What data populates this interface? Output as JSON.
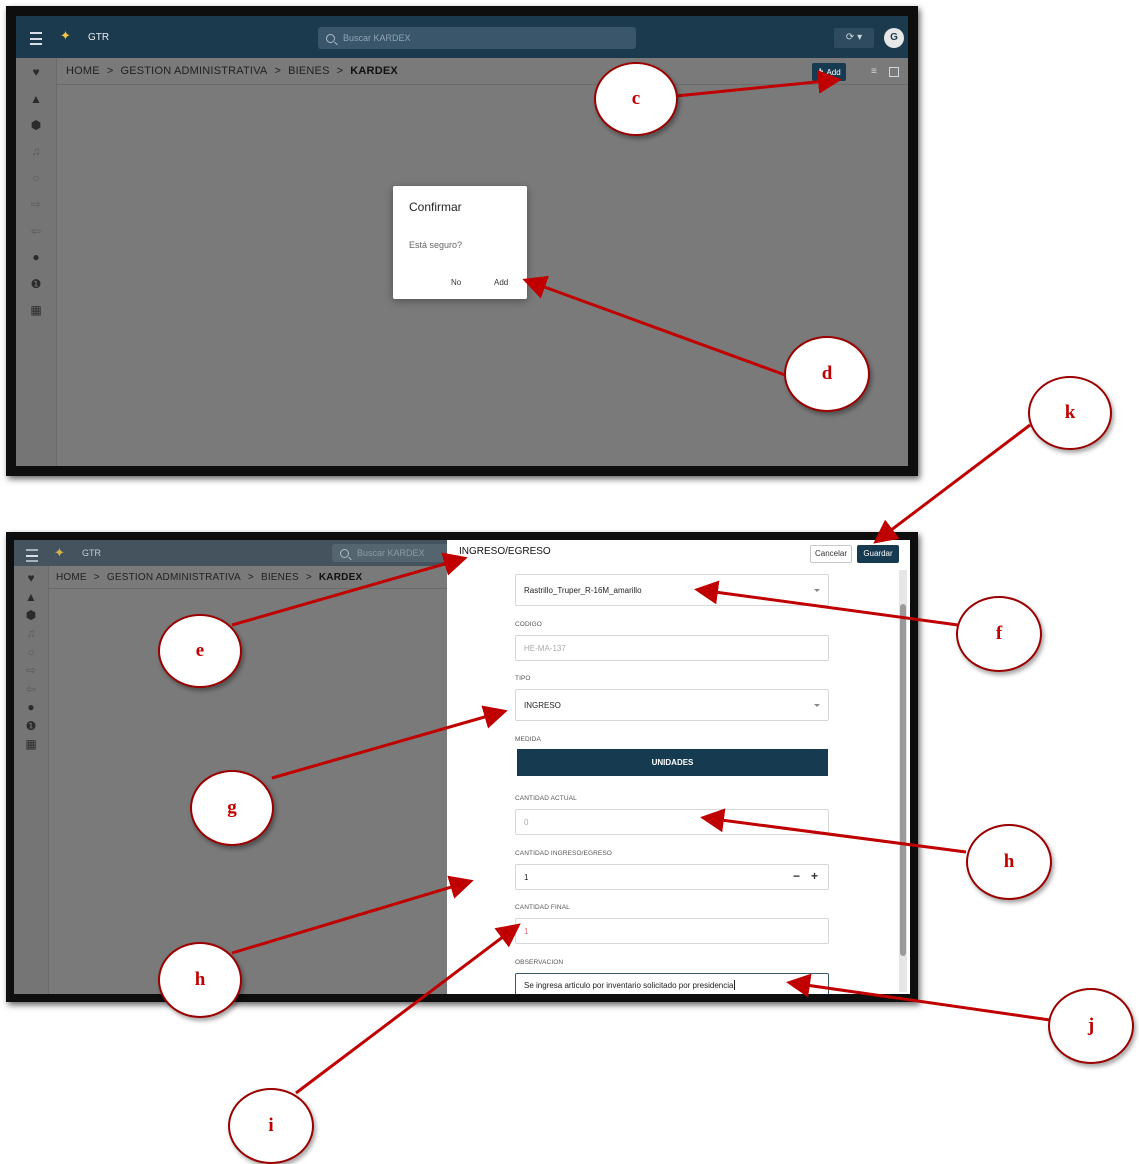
{
  "app": {
    "title": "GTR",
    "search_placeholder": "Buscar KARDEX",
    "avatar_initial": "G",
    "sync_label": "⟳  ▾"
  },
  "breadcrumb": {
    "items": [
      "HOME",
      "GESTION ADMINISTRATIVA",
      "BIENES"
    ],
    "current": "KARDEX",
    "separator": ">"
  },
  "toolbar": {
    "add_label": "Add"
  },
  "dialog": {
    "title": "Confirmar",
    "message": "Está seguro?",
    "no_label": "No",
    "add_label": "Add"
  },
  "form": {
    "title": "INGRESO/EGRESO",
    "cancel_label": "Cancelar",
    "save_label": "Guardar",
    "item_value": "Rastrillo_Truper_R-16M_amarillo",
    "codigo_label": "CODIGO",
    "codigo_value": "HE-MA-137",
    "tipo_label": "TIPO",
    "tipo_value": "INGRESO",
    "medida_label": "MEDIDA",
    "medida_value": "UNIDADES",
    "cantidad_actual_label": "CANTIDAD ACTUAL",
    "cantidad_actual_value": "0",
    "cantidad_ie_label": "CANTIDAD INGRESO/EGRESO",
    "cantidad_ie_value": "1",
    "cantidad_final_label": "CANTIDAD FINAL",
    "cantidad_final_value": "1",
    "observacion_label": "OBSERVACION",
    "observacion_value": "Se ingresa articulo por inventario solicitado por presidencia"
  },
  "callouts": [
    "c",
    "d",
    "k",
    "e",
    "f",
    "g",
    "h",
    "h",
    "i",
    "j"
  ],
  "colors": {
    "primary": "#163a50",
    "topbar": "#1b3a4e",
    "annotation": "#c00000"
  }
}
